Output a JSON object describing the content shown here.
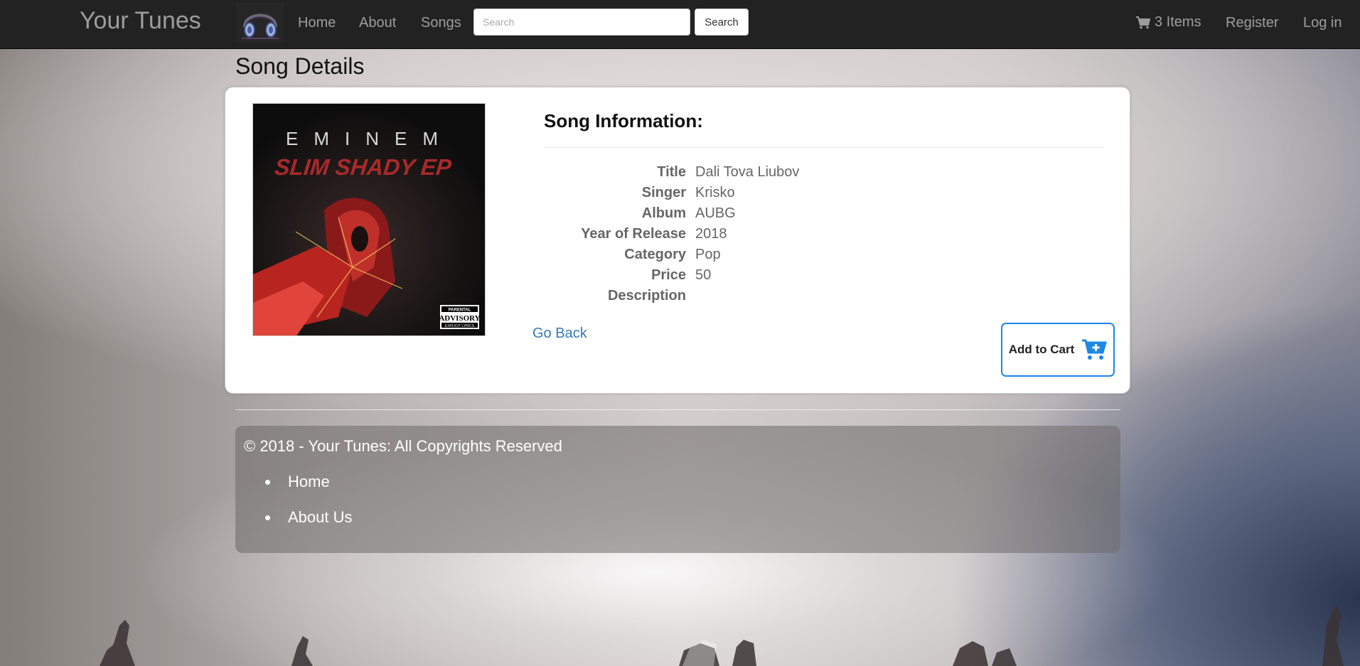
{
  "navbar": {
    "brand": "Your Tunes",
    "logo_icon": "headphones-icon",
    "links": {
      "home": "Home",
      "about": "About",
      "songs": "Songs"
    },
    "search_placeholder": "Search",
    "search_button": "Search",
    "cart_icon": "cart-icon",
    "cart_label": "3 Items",
    "register": "Register",
    "login": "Log in"
  },
  "page": {
    "title": "Song Details"
  },
  "card": {
    "cover": {
      "artist": "EMINEM",
      "album": "SLIM SHADY EP",
      "advisory_top": "PARENTAL",
      "advisory_mid": "ADVISORY",
      "advisory_bottom": "EXPLICIT LYRICS"
    },
    "info_heading": "Song Information:",
    "fields": [
      {
        "label": "Title",
        "value": "Dali Tova Liubov"
      },
      {
        "label": "Singer",
        "value": "Krisko"
      },
      {
        "label": "Album",
        "value": "AUBG"
      },
      {
        "label": "Year of Release",
        "value": "2018"
      },
      {
        "label": "Category",
        "value": "Pop"
      },
      {
        "label": "Price",
        "value": "50"
      },
      {
        "label": "Description",
        "value": ""
      }
    ],
    "go_back": "Go Back",
    "add_to_cart": "Add to Cart",
    "add_cart_icon": "cart-plus-icon",
    "accent_color": "#1e88e5"
  },
  "footer": {
    "copyright": "© 2018 - Your Tunes: All Copyrights Reserved",
    "links": [
      "Home",
      "About Us"
    ]
  }
}
